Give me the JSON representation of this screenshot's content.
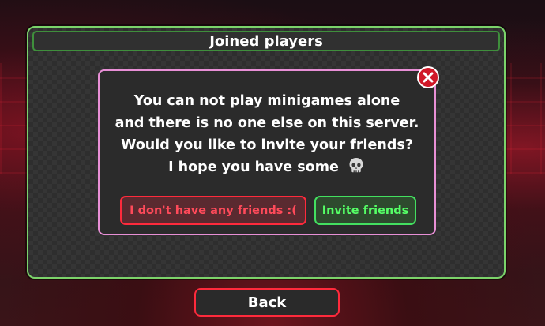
{
  "panel": {
    "title": "Joined players"
  },
  "dialog": {
    "message_lines": [
      "You can not play minigames alone",
      "and there is no one else on this server.",
      "Would you like to invite your friends?",
      "I hope you have some"
    ],
    "message_emoji": "skull-icon",
    "no_friends_label": "I don't have any friends :(",
    "invite_label": "Invite friends",
    "close_icon": "close-icon"
  },
  "footer": {
    "back_label": "Back"
  },
  "colors": {
    "panel_border": "#7bd36a",
    "dialog_border": "#e88fd6",
    "danger": "#ff2a3c",
    "success": "#43e060",
    "close_bg": "#d01828"
  }
}
